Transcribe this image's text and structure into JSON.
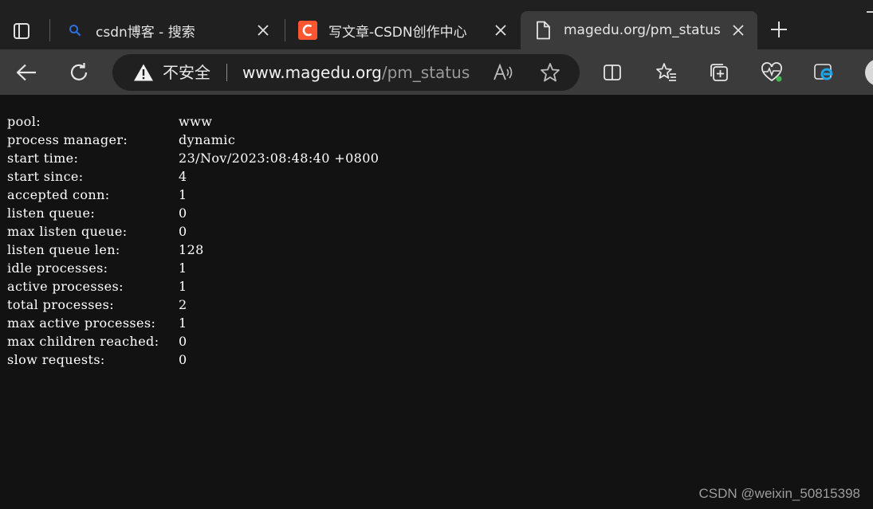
{
  "tabs": [
    {
      "title": "csdn博客 - 搜索",
      "icon": "search-icon",
      "active": false
    },
    {
      "title": "写文章-CSDN创作中心",
      "icon": "csdn-logo-icon",
      "active": false
    },
    {
      "title": "magedu.org/pm_status",
      "icon": "page-icon",
      "active": true
    }
  ],
  "address": {
    "security_label": "不安全",
    "host": "www.magedu.org",
    "path": "/pm_status"
  },
  "status_rows": [
    {
      "key": "pool:",
      "value": "www"
    },
    {
      "key": "process manager:",
      "value": "dynamic"
    },
    {
      "key": "start time:",
      "value": "23/Nov/2023:08:48:40 +0800"
    },
    {
      "key": "start since:",
      "value": "4"
    },
    {
      "key": "accepted conn:",
      "value": "1"
    },
    {
      "key": "listen queue:",
      "value": "0"
    },
    {
      "key": "max listen queue:",
      "value": "0"
    },
    {
      "key": "listen queue len:",
      "value": "128"
    },
    {
      "key": "idle processes:",
      "value": "1"
    },
    {
      "key": "active processes:",
      "value": "1"
    },
    {
      "key": "total processes:",
      "value": "2"
    },
    {
      "key": "max active processes:",
      "value": "1"
    },
    {
      "key": "max children reached:",
      "value": "0"
    },
    {
      "key": "slow requests:",
      "value": "0"
    }
  ],
  "watermark": "CSDN @weixin_50815398",
  "colors": {
    "tabstrip": "#202020",
    "toolbar": "#3b3b3b",
    "content_bg": "#121212",
    "csdn_brand": "#fc5531",
    "edge_blue": "#1fa6e8",
    "health_green": "#3fb950"
  }
}
